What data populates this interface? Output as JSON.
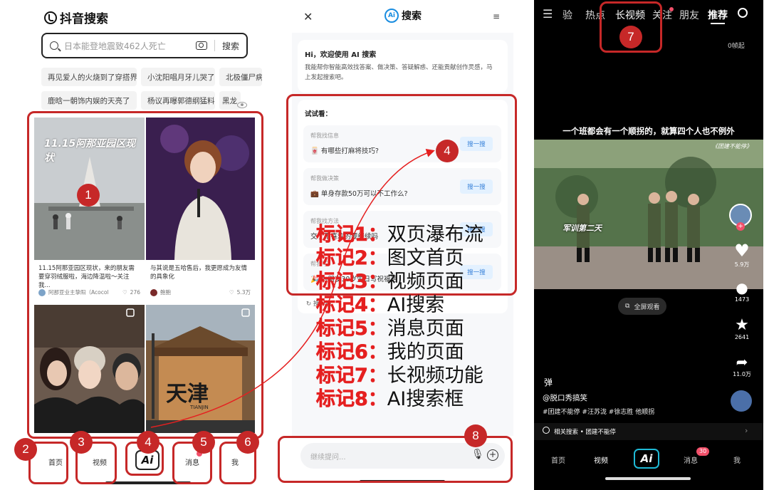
{
  "panel1": {
    "logo": "抖音搜索",
    "search_placeholder": "日本能登地震致462人死亡",
    "search_button": "搜索",
    "chips": [
      "再见爱人的火烧到了穿搭界",
      "小沈阳唱月牙儿哭了",
      "北极僵尸病",
      "鹿晗一朝饰内娱的天亮了",
      "杨议再曝郭德纲猛料",
      "黑龙"
    ],
    "cards": [
      {
        "overlay": "11.15阿那亚园区现状",
        "caption": "11.15阿那亚园区现状，来的朋友需要穿羽绒服啦，海边降温啦～关注我...",
        "author": "阿那亚业主挚阳（Acocol",
        "likes": "276"
      },
      {
        "caption": "与其说是五哈售后，我更愿成为友情的具象化",
        "author": "鲍鲍",
        "likes": "5.3万"
      },
      {
        "caption": ""
      },
      {
        "overlay": "天津",
        "sub": "TIANJIN",
        "caption": ""
      }
    ],
    "tabs": {
      "home": "首页",
      "video": "视频",
      "ai": "Ai",
      "messages": "消息",
      "me": "我"
    }
  },
  "panel2": {
    "title": "搜索",
    "greeting": "Hi，欢迎使用 AI 搜索",
    "intro": "我能帮你智能高效找答案、做决策、答疑解惑、还能贡献创作灵感，马上发起搜索吧。",
    "try_label": "试试看：",
    "suggestions": [
      {
        "label": "帮我找信息",
        "question": "有哪些打麻将技巧?",
        "button": "搜一搜"
      },
      {
        "label": "帮我做决策",
        "question": "单身存款50万可以不工作么?",
        "button": "搜一搜"
      },
      {
        "label": "帮我找方法",
        "question": "交了不喜欢的要继续吗",
        "button": "搜一搜"
      },
      {
        "label": "帮我写",
        "question": "为朋友30岁生日写祝福语",
        "button": "搜一搜"
      }
    ],
    "refresh": "换一换",
    "input_placeholder": "继续提问..."
  },
  "legend": [
    {
      "key": "标记1：",
      "value": "双页瀑布流"
    },
    {
      "key": "标记2：",
      "value": "图文首页"
    },
    {
      "key": "标记3：",
      "value": "视频页面"
    },
    {
      "key": "标记4：",
      "value": "AI搜索"
    },
    {
      "key": "标记5：",
      "value": "消息页面"
    },
    {
      "key": "标记6：",
      "value": "我的页面"
    },
    {
      "key": "标记7：",
      "value": "长视频功能"
    },
    {
      "key": "标记8：",
      "value": "AI搜索框"
    }
  ],
  "panel3": {
    "nav": [
      "验",
      "热点",
      "长视频",
      "关注",
      "朋友",
      "推荐"
    ],
    "top_right": "0帧起",
    "video_title": "一个班都会有一个顺拐的，就算四个人也不例外",
    "video_tag": "《团建不能停》",
    "scene_text": "军训第二天",
    "fullscreen": "全屏观看",
    "counts": {
      "likes": "5.9万",
      "comments": "1473",
      "stars": "2641",
      "shares": "11.0万"
    },
    "author": "@脱口秀搞笑",
    "tags": "#团建不能停 #汪苏泷 #徐志胜 他顺拐",
    "related": "相关搜索 • 团建不能停",
    "tabs": {
      "home": "首页",
      "video": "视频",
      "ai": "Ai",
      "messages": "消息",
      "me": "我"
    },
    "badge": "30"
  },
  "marks": [
    "1",
    "2",
    "3",
    "4",
    "5",
    "6",
    "7",
    "8"
  ],
  "colors": {
    "mark_red": "#c62828",
    "legend_red": "#e52020",
    "ai_cyan": "#1fbad6",
    "btn_blue": "#3680d8"
  }
}
